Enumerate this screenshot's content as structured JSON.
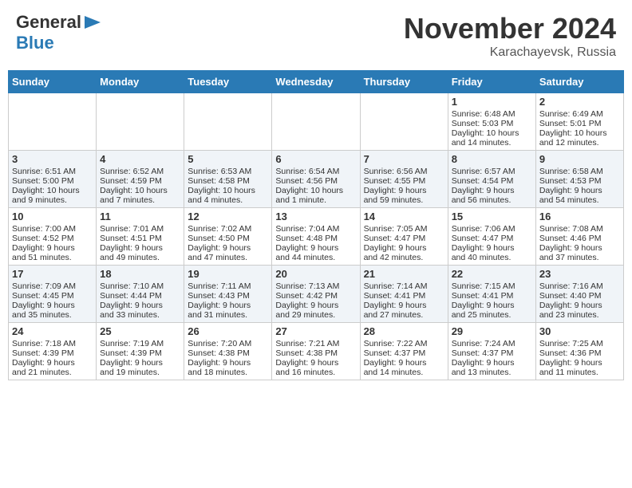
{
  "logo": {
    "general": "General",
    "blue": "Blue"
  },
  "title": "November 2024",
  "location": "Karachayevsk, Russia",
  "days_header": [
    "Sunday",
    "Monday",
    "Tuesday",
    "Wednesday",
    "Thursday",
    "Friday",
    "Saturday"
  ],
  "weeks": [
    [
      {
        "day": "",
        "info": ""
      },
      {
        "day": "",
        "info": ""
      },
      {
        "day": "",
        "info": ""
      },
      {
        "day": "",
        "info": ""
      },
      {
        "day": "",
        "info": ""
      },
      {
        "day": "1",
        "info": "Sunrise: 6:48 AM\nSunset: 5:03 PM\nDaylight: 10 hours\nand 14 minutes."
      },
      {
        "day": "2",
        "info": "Sunrise: 6:49 AM\nSunset: 5:01 PM\nDaylight: 10 hours\nand 12 minutes."
      }
    ],
    [
      {
        "day": "3",
        "info": "Sunrise: 6:51 AM\nSunset: 5:00 PM\nDaylight: 10 hours\nand 9 minutes."
      },
      {
        "day": "4",
        "info": "Sunrise: 6:52 AM\nSunset: 4:59 PM\nDaylight: 10 hours\nand 7 minutes."
      },
      {
        "day": "5",
        "info": "Sunrise: 6:53 AM\nSunset: 4:58 PM\nDaylight: 10 hours\nand 4 minutes."
      },
      {
        "day": "6",
        "info": "Sunrise: 6:54 AM\nSunset: 4:56 PM\nDaylight: 10 hours\nand 1 minute."
      },
      {
        "day": "7",
        "info": "Sunrise: 6:56 AM\nSunset: 4:55 PM\nDaylight: 9 hours\nand 59 minutes."
      },
      {
        "day": "8",
        "info": "Sunrise: 6:57 AM\nSunset: 4:54 PM\nDaylight: 9 hours\nand 56 minutes."
      },
      {
        "day": "9",
        "info": "Sunrise: 6:58 AM\nSunset: 4:53 PM\nDaylight: 9 hours\nand 54 minutes."
      }
    ],
    [
      {
        "day": "10",
        "info": "Sunrise: 7:00 AM\nSunset: 4:52 PM\nDaylight: 9 hours\nand 51 minutes."
      },
      {
        "day": "11",
        "info": "Sunrise: 7:01 AM\nSunset: 4:51 PM\nDaylight: 9 hours\nand 49 minutes."
      },
      {
        "day": "12",
        "info": "Sunrise: 7:02 AM\nSunset: 4:50 PM\nDaylight: 9 hours\nand 47 minutes."
      },
      {
        "day": "13",
        "info": "Sunrise: 7:04 AM\nSunset: 4:48 PM\nDaylight: 9 hours\nand 44 minutes."
      },
      {
        "day": "14",
        "info": "Sunrise: 7:05 AM\nSunset: 4:47 PM\nDaylight: 9 hours\nand 42 minutes."
      },
      {
        "day": "15",
        "info": "Sunrise: 7:06 AM\nSunset: 4:47 PM\nDaylight: 9 hours\nand 40 minutes."
      },
      {
        "day": "16",
        "info": "Sunrise: 7:08 AM\nSunset: 4:46 PM\nDaylight: 9 hours\nand 37 minutes."
      }
    ],
    [
      {
        "day": "17",
        "info": "Sunrise: 7:09 AM\nSunset: 4:45 PM\nDaylight: 9 hours\nand 35 minutes."
      },
      {
        "day": "18",
        "info": "Sunrise: 7:10 AM\nSunset: 4:44 PM\nDaylight: 9 hours\nand 33 minutes."
      },
      {
        "day": "19",
        "info": "Sunrise: 7:11 AM\nSunset: 4:43 PM\nDaylight: 9 hours\nand 31 minutes."
      },
      {
        "day": "20",
        "info": "Sunrise: 7:13 AM\nSunset: 4:42 PM\nDaylight: 9 hours\nand 29 minutes."
      },
      {
        "day": "21",
        "info": "Sunrise: 7:14 AM\nSunset: 4:41 PM\nDaylight: 9 hours\nand 27 minutes."
      },
      {
        "day": "22",
        "info": "Sunrise: 7:15 AM\nSunset: 4:41 PM\nDaylight: 9 hours\nand 25 minutes."
      },
      {
        "day": "23",
        "info": "Sunrise: 7:16 AM\nSunset: 4:40 PM\nDaylight: 9 hours\nand 23 minutes."
      }
    ],
    [
      {
        "day": "24",
        "info": "Sunrise: 7:18 AM\nSunset: 4:39 PM\nDaylight: 9 hours\nand 21 minutes."
      },
      {
        "day": "25",
        "info": "Sunrise: 7:19 AM\nSunset: 4:39 PM\nDaylight: 9 hours\nand 19 minutes."
      },
      {
        "day": "26",
        "info": "Sunrise: 7:20 AM\nSunset: 4:38 PM\nDaylight: 9 hours\nand 18 minutes."
      },
      {
        "day": "27",
        "info": "Sunrise: 7:21 AM\nSunset: 4:38 PM\nDaylight: 9 hours\nand 16 minutes."
      },
      {
        "day": "28",
        "info": "Sunrise: 7:22 AM\nSunset: 4:37 PM\nDaylight: 9 hours\nand 14 minutes."
      },
      {
        "day": "29",
        "info": "Sunrise: 7:24 AM\nSunset: 4:37 PM\nDaylight: 9 hours\nand 13 minutes."
      },
      {
        "day": "30",
        "info": "Sunrise: 7:25 AM\nSunset: 4:36 PM\nDaylight: 9 hours\nand 11 minutes."
      }
    ]
  ]
}
